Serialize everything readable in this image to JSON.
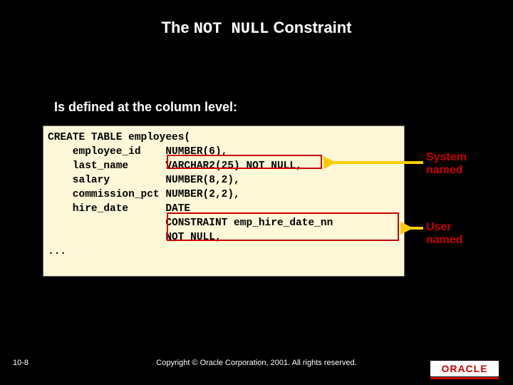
{
  "title_prefix": "The ",
  "title_code": "NOT NULL",
  "title_suffix": " Constraint",
  "subtitle": "Is defined at the column level:",
  "codebox": "CREATE TABLE employees(\n    employee_id    NUMBER(6),\n    last_name      VARCHAR2(25) NOT NULL,\n    salary         NUMBER(8,2),\n    commission_pct NUMBER(2,2),\n    hire_date      DATE\n                   CONSTRAINT emp_hire_date_nn\n                   NOT NULL,\n...",
  "label1_a": "System",
  "label1_b": "named",
  "label2_a": "User",
  "label2_b": "named",
  "slidenum": "10-8",
  "copyright": "Copyright © Oracle Corporation, 2001. All rights reserved.",
  "logo": "ORACLE"
}
